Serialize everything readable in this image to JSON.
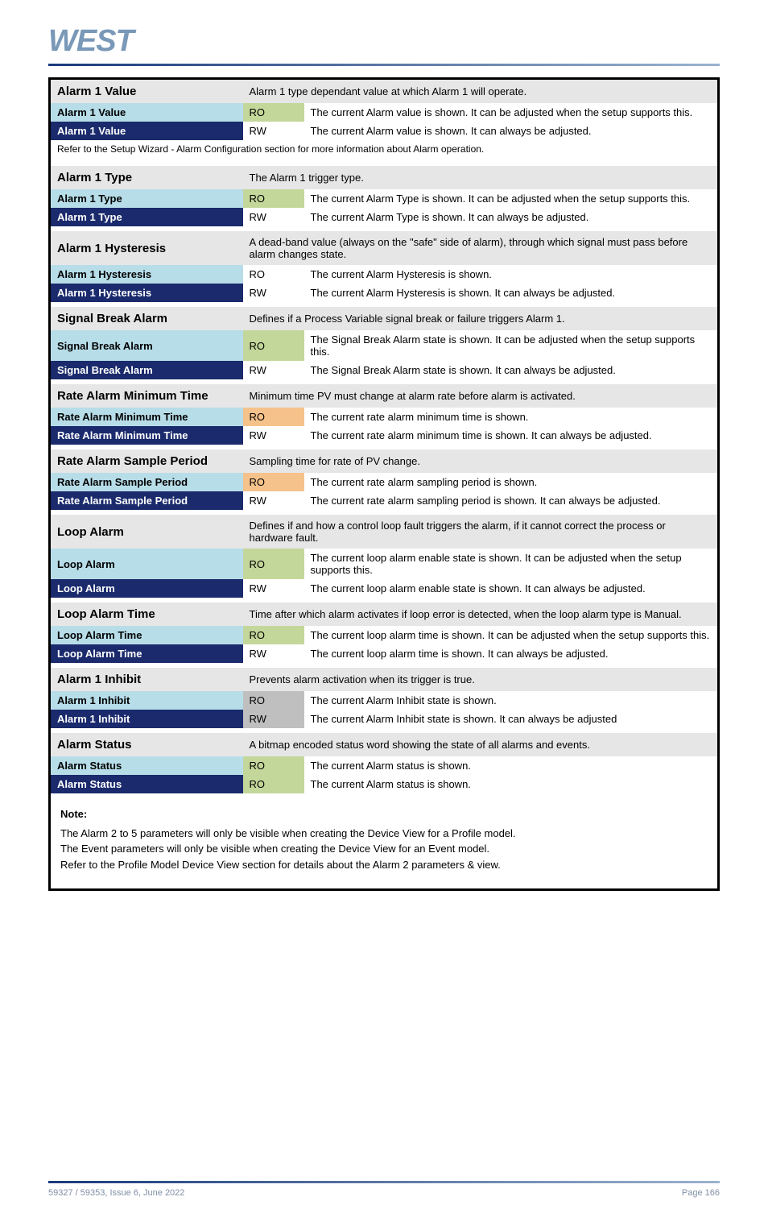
{
  "header": {
    "logo": "WEST"
  },
  "footer": {
    "left": "59327 / 59353, Issue 6, June 2022",
    "right": "Page 166"
  },
  "notes": {
    "title": "Note:",
    "line1": "The Alarm 2 to 5 parameters will only be visible when creating the Device View for a Profile model.",
    "line2": "The Event parameters will only be visible when creating the Device View for an Event model.",
    "line3": "Refer to the Profile Model Device View section for details about the Alarm 2 parameters & view."
  },
  "params": [
    {
      "name": "Alarm 1 Value",
      "desc": "Alarm 1 type dependant value at which Alarm 1 will operate.",
      "rows": [
        {
          "swatch": "lt",
          "chip": "g",
          "label": "RO",
          "text": "The current Alarm value is shown. It can be adjusted when the setup supports this."
        },
        {
          "swatch": "dk",
          "chip": null,
          "label": "RW",
          "text": "The current Alarm value is shown. It can always be adjusted."
        }
      ],
      "post": "Refer to the Setup Wizard - Alarm Configuration section for more information about Alarm operation."
    },
    {
      "name": "Alarm 1 Type",
      "desc": "The Alarm 1 trigger type.",
      "rows": [
        {
          "swatch": "lt",
          "chip": "g",
          "label": "RO",
          "text": "The current Alarm Type is shown. It can be adjusted when the setup supports this."
        },
        {
          "swatch": "dk",
          "chip": null,
          "label": "RW",
          "text": "The current Alarm Type is shown. It can always be adjusted."
        }
      ],
      "post": ""
    },
    {
      "name": "Alarm 1 Hysteresis",
      "desc": "A dead-band value (always on the \"safe\" side of alarm), through which signal must pass before alarm changes state.",
      "rows": [
        {
          "swatch": "lt",
          "chip": null,
          "label": "RO",
          "text": "The current Alarm Hysteresis is shown."
        },
        {
          "swatch": "dk",
          "chip": null,
          "label": "RW",
          "text": "The current Alarm Hysteresis is shown. It can always be adjusted."
        }
      ],
      "post": ""
    },
    {
      "name": "Signal Break Alarm",
      "desc": "Defines if a Process Variable signal break or failure triggers Alarm 1.",
      "rows": [
        {
          "swatch": "lt",
          "chip": "g",
          "label": "RO",
          "text": "The Signal Break Alarm state is shown. It can be adjusted when the setup supports this."
        },
        {
          "swatch": "dk",
          "chip": null,
          "label": "RW",
          "text": "The Signal Break Alarm state is shown. It can always be adjusted."
        }
      ],
      "post": ""
    },
    {
      "name": "Rate Alarm Minimum Time",
      "desc": "Minimum time PV must change at alarm rate before alarm is activated.",
      "rows": [
        {
          "swatch": "lt",
          "chip": "o",
          "label": "RO",
          "text": "The current rate alarm minimum time is shown."
        },
        {
          "swatch": "dk",
          "chip": null,
          "label": "RW",
          "text": "The current rate alarm minimum time is shown. It can always be adjusted."
        }
      ],
      "post": ""
    },
    {
      "name": "Rate Alarm Sample Period",
      "desc": "Sampling time for rate of PV change.",
      "rows": [
        {
          "swatch": "lt",
          "chip": "o",
          "label": "RO",
          "text": "The current rate alarm sampling period is shown."
        },
        {
          "swatch": "dk",
          "chip": null,
          "label": "RW",
          "text": "The current rate alarm sampling period is shown. It can always be adjusted."
        }
      ],
      "post": ""
    },
    {
      "name": "Loop Alarm",
      "desc": "Defines if and how a control loop fault triggers the alarm, if it cannot correct the process or hardware fault.",
      "rows": [
        {
          "swatch": "lt",
          "chip": "g",
          "label": "RO",
          "text": "The current loop alarm enable state is shown. It can be adjusted when the setup supports this."
        },
        {
          "swatch": "dk",
          "chip": null,
          "label": "RW",
          "text": "The current loop alarm enable state is shown. It can always be adjusted."
        }
      ],
      "post": ""
    },
    {
      "name": "Loop Alarm Time",
      "desc": "Time after which alarm activates if loop error is detected, when the loop alarm type is Manual.",
      "rows": [
        {
          "swatch": "lt",
          "chip": "g",
          "label": "RO",
          "text": "The current loop alarm time is shown. It can be adjusted when the setup supports this."
        },
        {
          "swatch": "dk",
          "chip": null,
          "label": "RW",
          "text": "The current loop alarm time is shown. It can always be adjusted."
        }
      ],
      "post": ""
    },
    {
      "name": "Alarm 1 Inhibit",
      "desc": "Prevents alarm activation when its trigger is true.",
      "rows": [
        {
          "swatch": "lt",
          "chip": "s",
          "label": "RO",
          "text": "The current Alarm Inhibit state is shown."
        },
        {
          "swatch": "dk",
          "chip": "s",
          "label": "RW",
          "text": "The current Alarm Inhibit state is shown. It can always be adjusted"
        }
      ],
      "post": ""
    },
    {
      "name": "Alarm Status",
      "desc": "A bitmap encoded status word showing the state of all alarms and events.",
      "rows": [
        {
          "swatch": "lt",
          "chip": "g",
          "label": "RO",
          "text": "The current Alarm status is shown."
        },
        {
          "swatch": "dk",
          "chip": "g",
          "label": "RO",
          "text": "The current Alarm status is shown."
        }
      ],
      "post": ""
    }
  ]
}
